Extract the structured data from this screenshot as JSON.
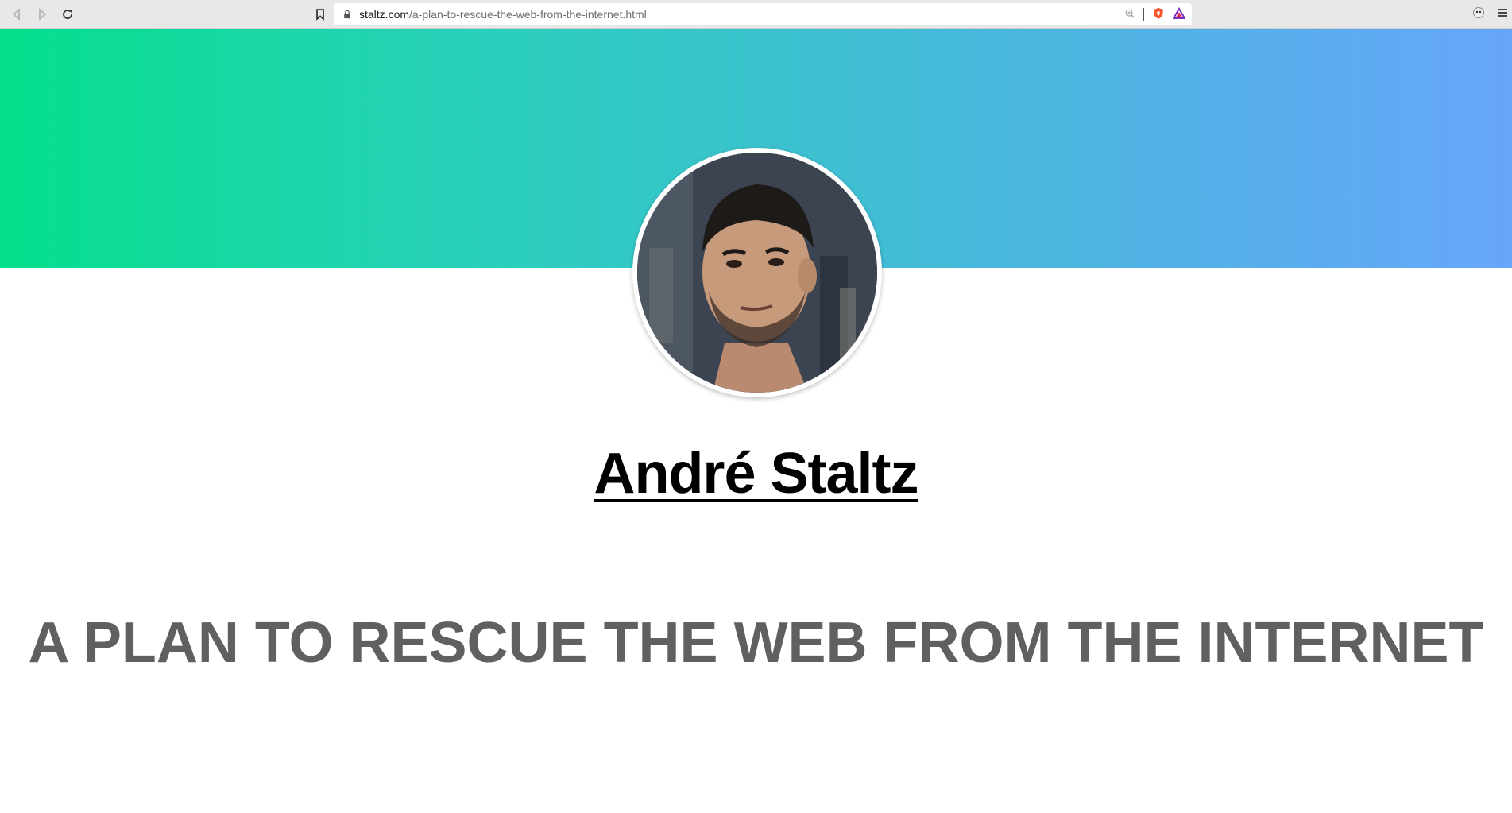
{
  "browser": {
    "url_host": "staltz.com",
    "url_path": "/a-plan-to-rescue-the-web-from-the-internet.html",
    "icons": {
      "back": "back-arrow-icon",
      "forward": "forward-arrow-icon",
      "reload": "reload-icon",
      "bookmark": "bookmark-icon",
      "lock": "lock-icon",
      "zoom": "zoom-icon",
      "brave_shield": "brave-shield-icon",
      "rewards": "brave-rewards-icon",
      "extension": "extension-icon",
      "menu": "hamburger-menu-icon"
    }
  },
  "page": {
    "hero_colors": [
      "#05df8c",
      "#2bcfbd",
      "#49b7dd",
      "#67a6fb"
    ],
    "author_name": "André Staltz",
    "post_title": "A PLAN TO RESCUE THE WEB FROM THE INTERNET"
  }
}
